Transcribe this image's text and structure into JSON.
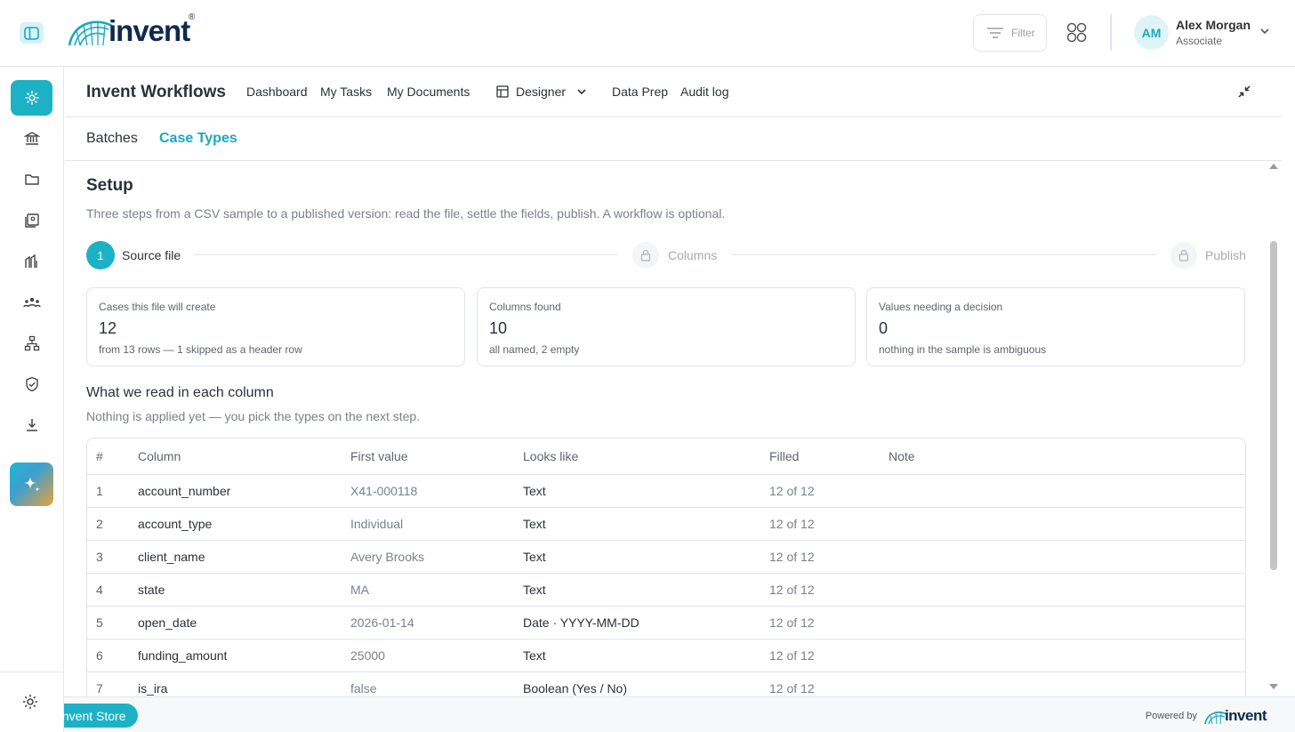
{
  "brand": {
    "logo_text": "invent",
    "registered_mark": "®"
  },
  "header": {
    "filter_label": "Filter",
    "user": {
      "initials": "AM",
      "name": "Alex Morgan",
      "role": "Associate"
    }
  },
  "left_rail": {
    "icons": [
      "settings-cog-icon",
      "bank-icon",
      "folder-icon",
      "documents-icon",
      "tiles-icon",
      "team-icon",
      "org-chart-icon",
      "verified-shield-icon",
      "download-icon"
    ],
    "active_item": "settings-cog-icon",
    "ai_button_icon": "sparkle-icon",
    "bottom_icon": "gear-icon"
  },
  "app_nav": {
    "title": "Invent Workflows",
    "links": [
      "Dashboard",
      "My Tasks",
      "My Documents"
    ],
    "designer_label": "Designer",
    "links_after": [
      "Data Prep",
      "Audit log"
    ]
  },
  "subtabs": {
    "items": [
      "Batches",
      "Case Types"
    ],
    "active": "Case Types"
  },
  "setup": {
    "title": "Setup",
    "description": "Three steps from a CSV sample to a published version: read the file, settle the fields, publish. A workflow is optional.",
    "steps": [
      {
        "number": "1",
        "label": "Source file",
        "state": "active"
      },
      {
        "label": "Columns",
        "state": "locked"
      },
      {
        "label": "Publish",
        "state": "locked"
      }
    ]
  },
  "stats": [
    {
      "label": "Cases this file will create",
      "value": "12",
      "sub": "from 13 rows — 1 skipped as a header row"
    },
    {
      "label": "Columns found",
      "value": "10",
      "sub": "all named, 2 empty"
    },
    {
      "label": "Values needing a decision",
      "value": "0",
      "sub": "nothing in the sample is ambiguous"
    }
  ],
  "columns_section": {
    "title": "What we read in each column",
    "description": "Nothing is applied yet — you pick the types on the next step.",
    "headers": [
      "#",
      "Column",
      "First value",
      "Looks like",
      "Filled",
      "Note"
    ],
    "rows": [
      {
        "num": "1",
        "column": "account_number",
        "first": "X41-000118",
        "looks": "Text",
        "filled": "12 of 12",
        "note": ""
      },
      {
        "num": "2",
        "column": "account_type",
        "first": "Individual",
        "looks": "Text",
        "filled": "12 of 12",
        "note": ""
      },
      {
        "num": "3",
        "column": "client_name",
        "first": "Avery Brooks",
        "looks": "Text",
        "filled": "12 of 12",
        "note": ""
      },
      {
        "num": "4",
        "column": "state",
        "first": "MA",
        "looks": "Text",
        "filled": "12 of 12",
        "note": ""
      },
      {
        "num": "5",
        "column": "open_date",
        "first": "2026-01-14",
        "looks": "Date · YYYY-MM-DD",
        "filled": "12 of 12",
        "note": ""
      },
      {
        "num": "6",
        "column": "funding_amount",
        "first": "25000",
        "looks": "Text",
        "filled": "12 of 12",
        "note": ""
      },
      {
        "num": "7",
        "column": "is_ira",
        "first": "false",
        "looks": "Boolean (Yes / No)",
        "filled": "12 of 12",
        "note": ""
      }
    ]
  },
  "footer": {
    "store_label": "Invent Store",
    "powered_by": "Powered by",
    "powered_logo": "invent"
  },
  "colors": {
    "accent": "#1db1c6",
    "text": "#2c3138",
    "muted": "#7b8188",
    "border": "#e1e4e8"
  }
}
